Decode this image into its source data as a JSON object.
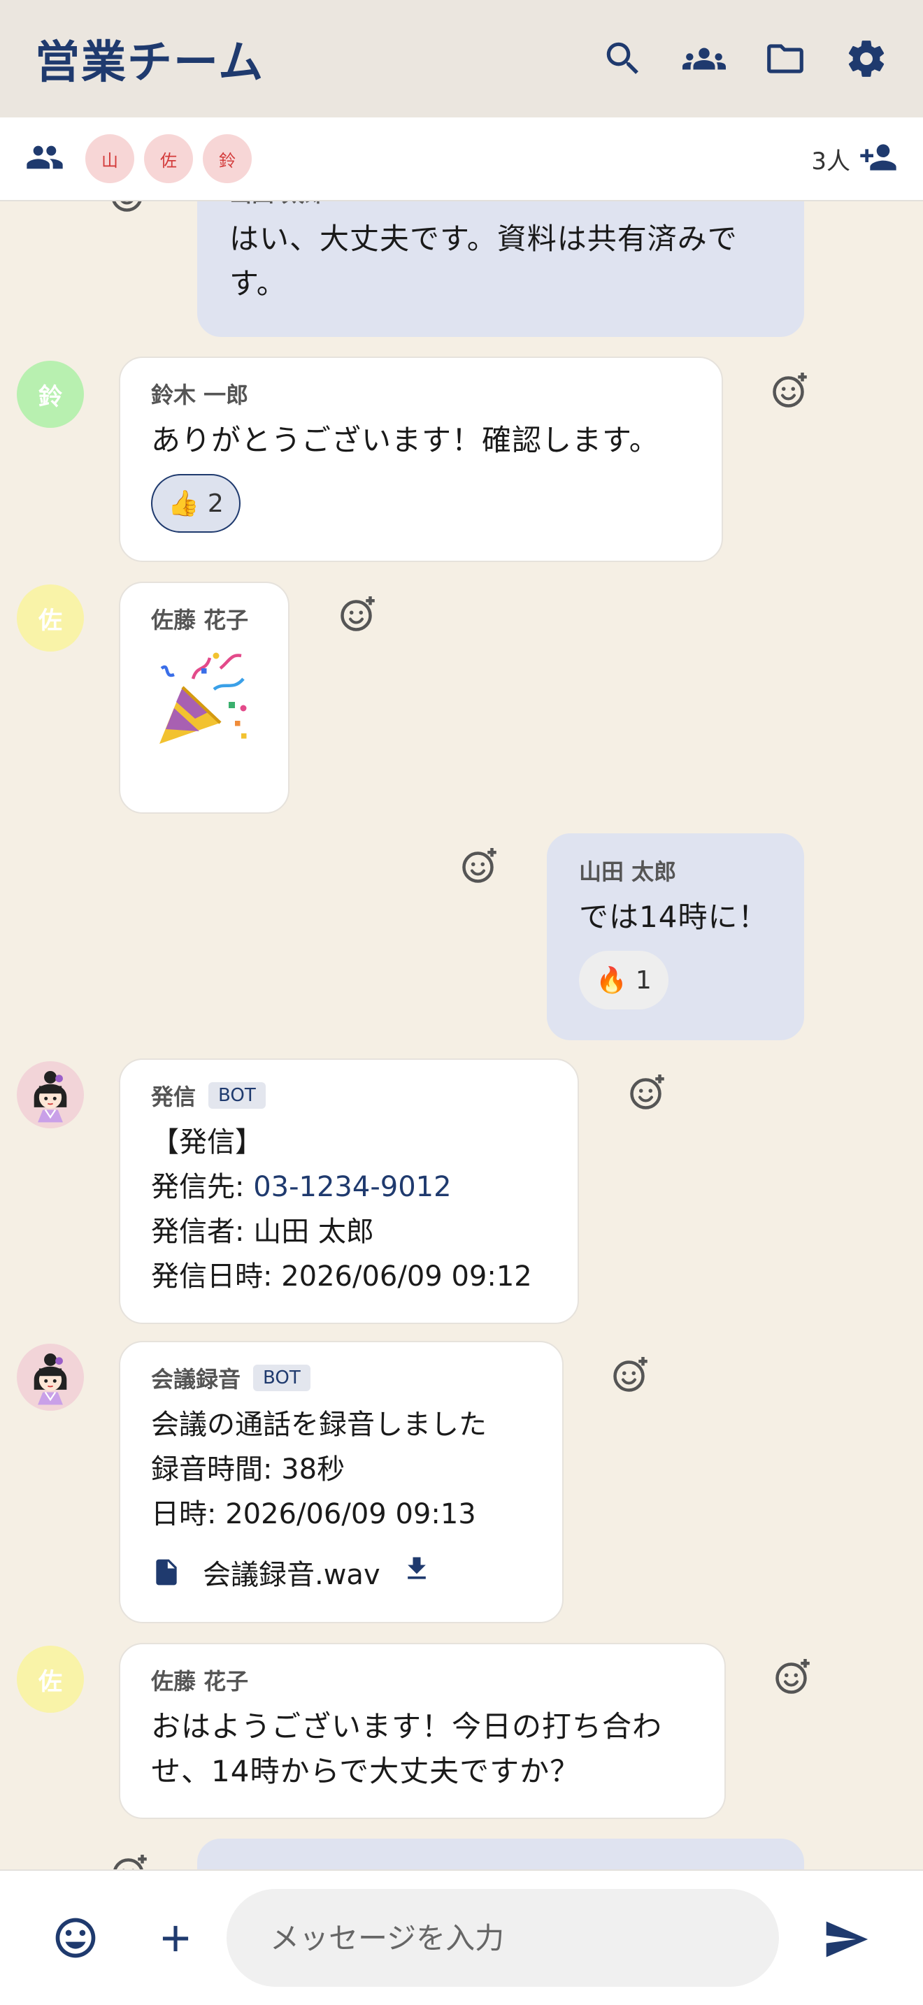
{
  "header": {
    "title": "営業チーム",
    "icons": [
      "search-icon",
      "group-icon",
      "folder-icon",
      "gear-icon"
    ]
  },
  "members_bar": {
    "chips": [
      "山",
      "佐",
      "鈴"
    ],
    "count": "3人"
  },
  "messages": [
    {
      "id": "m0",
      "mine": true,
      "sender": "山田 太郎",
      "text": "はい、大丈夫です。資料は共有済みです。"
    },
    {
      "id": "m1",
      "mine": false,
      "avatar_initial": "鈴",
      "avatar_color": "#b8f0b0",
      "sender": "鈴木 一郎",
      "text": "ありがとうございます！確認します。",
      "reaction": {
        "emoji": "👍",
        "count": "2",
        "selected": true
      }
    },
    {
      "id": "m2",
      "mine": false,
      "avatar_initial": "佐",
      "avatar_color": "#f9f3a8",
      "sender": "佐藤 花子",
      "sticker": "party-popper"
    },
    {
      "id": "m3",
      "mine": true,
      "sender": "山田 太郎",
      "text": "では14時に！",
      "reaction": {
        "emoji": "🔥",
        "count": "1",
        "selected": false
      }
    },
    {
      "id": "m4",
      "mine": false,
      "bot": true,
      "sender": "発信",
      "badge": "BOT",
      "lines": {
        "title": "【発信】",
        "to_label": "発信先: ",
        "to_value": "03-1234-9012",
        "from": "発信者: 山田 太郎",
        "time": "発信日時: 2026/06/09 09:12"
      }
    },
    {
      "id": "m5",
      "mine": false,
      "bot": true,
      "sender": "会議録音",
      "badge": "BOT",
      "lines": {
        "title": "会議の通話を録音しました",
        "duration": "録音時間: 38秒",
        "time": "日時: 2026/06/09 09:13"
      },
      "file": {
        "name": "会議録音.wav"
      }
    },
    {
      "id": "m6",
      "mine": false,
      "avatar_initial": "佐",
      "avatar_color": "#f9f3a8",
      "sender": "佐藤 花子",
      "text": "おはようございます！今日の打ち合わせ、14時からで大丈夫ですか？"
    }
  ],
  "composer": {
    "placeholder": "メッセージを入力"
  },
  "colors": {
    "primary": "#1f3a6e",
    "background": "#f5efe4",
    "header_bg": "#ebe6df",
    "mine_bubble": "#dfe3f0",
    "chip_bg": "#f7d6d6",
    "chip_text": "#d33a3a"
  }
}
